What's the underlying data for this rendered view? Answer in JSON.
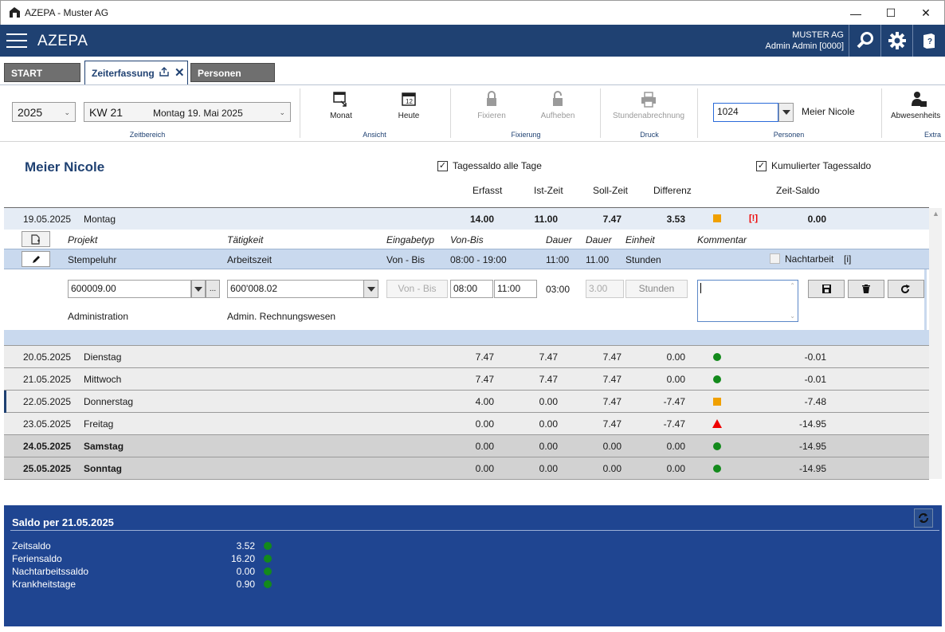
{
  "window": {
    "title": "AZEPA - Muster AG",
    "minimize": "—",
    "maximize": "☐",
    "close": "✕"
  },
  "appbar": {
    "name": "AZEPA",
    "company": "MUSTER AG",
    "user": "Admin Admin [0000]",
    "icons": [
      "search-icon",
      "gear-icon",
      "help-book-icon"
    ]
  },
  "tabs": [
    {
      "label": "START"
    },
    {
      "label": "Zeiterfassung"
    },
    {
      "label": "Personen"
    }
  ],
  "ribbon": {
    "year": "2025",
    "week": "KW 21",
    "week_date": "Montag 19. Mai 2025",
    "zeitbereich": "Zeitbereich",
    "monat": "Monat",
    "heute": "Heute",
    "ansicht": "Ansicht",
    "fixieren": "Fixieren",
    "aufheben": "Aufheben",
    "fixierung": "Fixierung",
    "stundenabrechnung": "Stundenabrechnung",
    "druck": "Druck",
    "person_id": "1024",
    "person_name": "Meier Nicole",
    "personen": "Personen",
    "abwesenheit": "Abwesenheits",
    "extra": "Extra"
  },
  "person": {
    "name": "Meier Nicole",
    "chk_tagessaldo": "Tagessaldo alle Tage",
    "chk_kumuliert": "Kumulierter Tagessaldo"
  },
  "columns": {
    "erfasst": "Erfasst",
    "ist": "Ist-Zeit",
    "soll": "Soll-Zeit",
    "diff": "Differenz",
    "saldo": "Zeit-Saldo"
  },
  "day_open": {
    "date": "19.05.2025",
    "day": "Montag",
    "erfasst": "14.00",
    "ist": "11.00",
    "soll": "7.47",
    "diff": "3.53",
    "warn": "[!]",
    "saldo": "0.00",
    "status": "orange-square"
  },
  "detail_head": {
    "projekt": "Projekt",
    "taetigkeit": "Tätigkeit",
    "eingabetyp": "Eingabetyp",
    "vonbis": "Von-Bis",
    "dauer": "Dauer",
    "dauer2": "Dauer",
    "einheit": "Einheit",
    "kommentar": "Kommentar"
  },
  "entry": {
    "projekt": "Stempeluhr",
    "taetigkeit": "Arbeitszeit",
    "eingabetyp": "Von - Bis",
    "vonbis": "08:00 - 19:00",
    "dauer": "11:00",
    "dauer2": "11.00",
    "einheit": "Stunden",
    "nachtarbeit": "Nachtarbeit",
    "info": "[i]"
  },
  "edit": {
    "projekt": "600009.00",
    "taetigkeit": "600'008.02",
    "typ": "Von - Bis",
    "von": "08:00",
    "bis": "11:00",
    "dauer": "03:00",
    "dauer2": "3.00",
    "einheit": "Stunden",
    "projekt_name": "Administration",
    "taetigkeit_name": "Admin. Rechnungswesen",
    "ellipsis": "..."
  },
  "days": [
    {
      "date": "20.05.2025",
      "day": "Dienstag",
      "erfasst": "7.47",
      "ist": "7.47",
      "soll": "7.47",
      "diff": "0.00",
      "status": "dot",
      "saldo": "-0.01",
      "weekend": false
    },
    {
      "date": "21.05.2025",
      "day": "Mittwoch",
      "erfasst": "7.47",
      "ist": "7.47",
      "soll": "7.47",
      "diff": "0.00",
      "status": "dot",
      "saldo": "-0.01",
      "weekend": false
    },
    {
      "date": "22.05.2025",
      "day": "Donnerstag",
      "erfasst": "4.00",
      "ist": "0.00",
      "soll": "7.47",
      "diff": "-7.47",
      "status": "sq",
      "saldo": "-7.48",
      "weekend": false
    },
    {
      "date": "23.05.2025",
      "day": "Freitag",
      "erfasst": "0.00",
      "ist": "0.00",
      "soll": "7.47",
      "diff": "-7.47",
      "status": "tri",
      "saldo": "-14.95",
      "weekend": false
    },
    {
      "date": "24.05.2025",
      "day": "Samstag",
      "erfasst": "0.00",
      "ist": "0.00",
      "soll": "0.00",
      "diff": "0.00",
      "status": "dot",
      "saldo": "-14.95",
      "weekend": true
    },
    {
      "date": "25.05.2025",
      "day": "Sonntag",
      "erfasst": "0.00",
      "ist": "0.00",
      "soll": "0.00",
      "diff": "0.00",
      "status": "dot",
      "saldo": "-14.95",
      "weekend": true
    }
  ],
  "saldo": {
    "title": "Saldo per 21.05.2025",
    "items": [
      {
        "label": "Zeitsaldo",
        "value": "3.52"
      },
      {
        "label": "Feriensaldo",
        "value": "16.20"
      },
      {
        "label": "Nachtarbeitssaldo",
        "value": "0.00"
      },
      {
        "label": "Krankheitstage",
        "value": "0.90"
      }
    ]
  },
  "colors": {
    "brand": "#1f4172",
    "footer": "#1f4591",
    "ok": "#138a1c",
    "warn": "#f0a000",
    "error": "#e00000"
  }
}
